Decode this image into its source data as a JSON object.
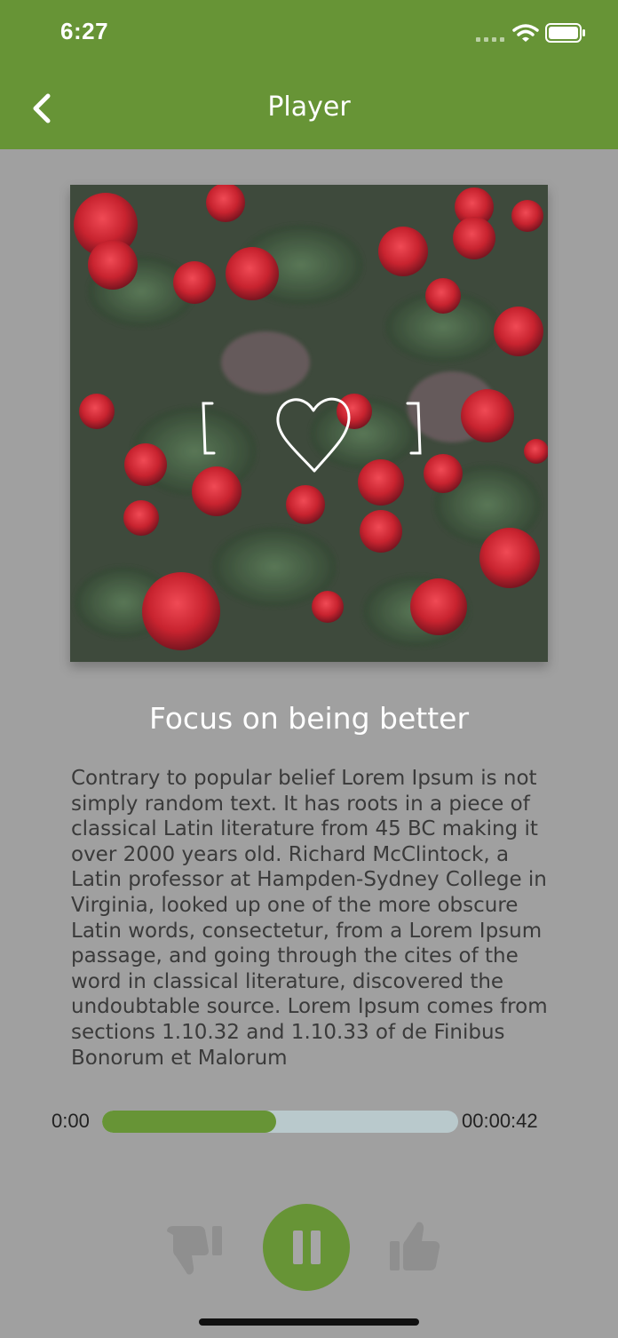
{
  "status_bar": {
    "time": "6:27",
    "signal_icon": "cellular-signal-icon",
    "wifi_icon": "wifi-icon",
    "battery_icon": "battery-icon"
  },
  "app_bar": {
    "title": "Player",
    "back_icon": "chevron-left-icon",
    "background_color": "#679436"
  },
  "cover": {
    "overlay_icon": "heart-outline-icon"
  },
  "track": {
    "title": "Focus on being better",
    "description": "Contrary to popular belief  Lorem Ipsum is not simply random text. It has roots in a piece of classical Latin literature from 45 BC making it over 2000 years old. Richard McClintock, a Latin professor at Hampden-Sydney College in Virginia, looked up one of the more obscure Latin words, consectetur, from a Lorem Ipsum passage, and going through the cites of the word in classical literature, discovered the undoubtable source. Lorem Ipsum comes from sections 1.10.32 and 1.10.33 of de Finibus Bonorum et Malorum"
  },
  "player": {
    "current_time": "0:00",
    "total_time": "00:00:42",
    "progress_fraction": 0.49,
    "progress_color": "#679436",
    "track_color": "#b9c9cc",
    "dislike_icon": "thumbs-down-icon",
    "play_state_icon": "pause-icon",
    "like_icon": "thumbs-up-icon"
  }
}
